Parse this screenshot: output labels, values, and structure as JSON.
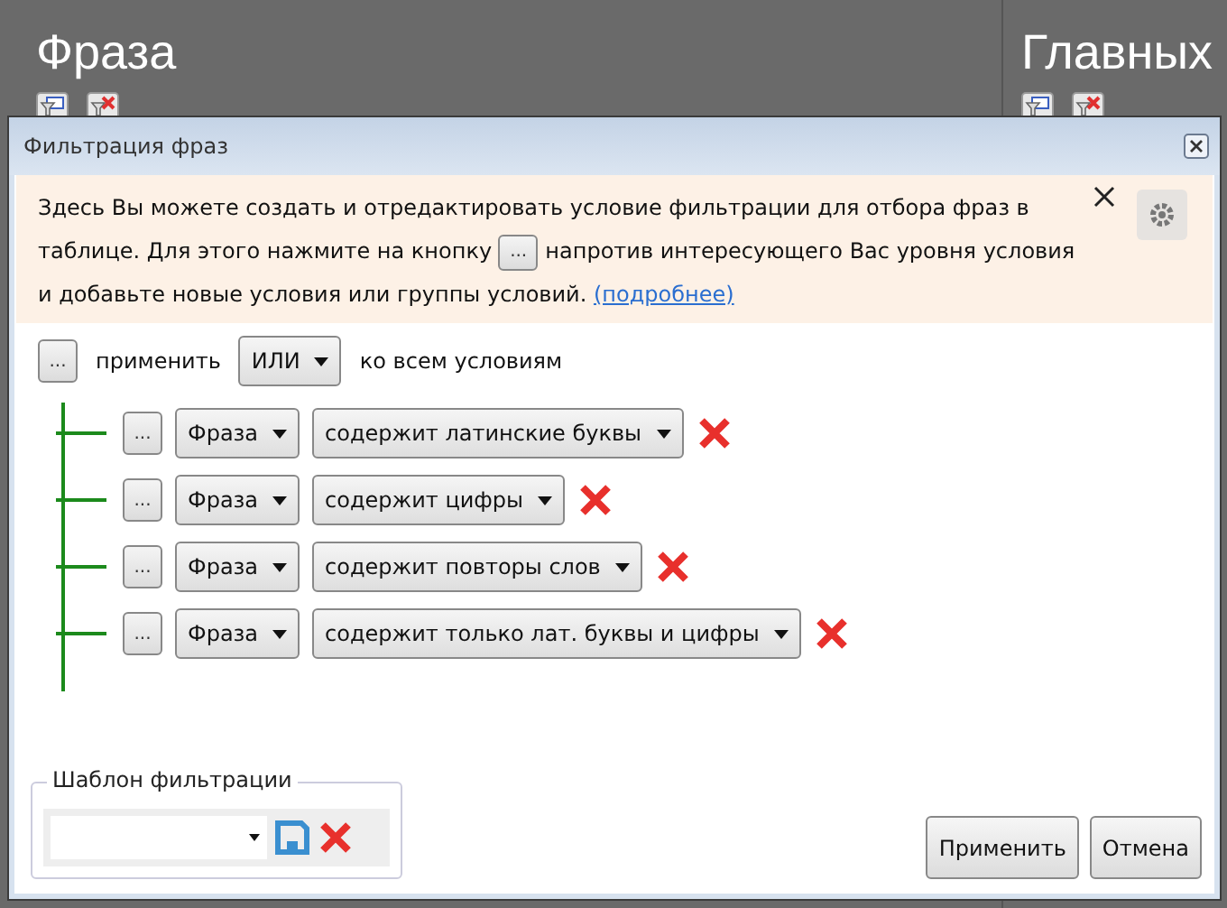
{
  "background": {
    "panels": [
      {
        "title": "Фраза"
      },
      {
        "title": "Главных"
      }
    ]
  },
  "dialog": {
    "title": "Фильтрация фраз",
    "info": {
      "text_before": "Здесь Вы можете создать и отредактировать условие фильтрации для отбора фраз в таблице. Для этого нажмите на кнопку",
      "button": "...",
      "text_after": "напротив интересующего Вас уровня условия и добавьте новые условия или группы условий.",
      "link": "(подробнее)"
    },
    "root": {
      "button": "...",
      "label_before": "применить",
      "operator": "ИЛИ",
      "label_after": "ко всем условиям"
    },
    "conditions": [
      {
        "button": "...",
        "field": "Фраза",
        "condition": "содержит латинские буквы"
      },
      {
        "button": "...",
        "field": "Фраза",
        "condition": "содержит цифры"
      },
      {
        "button": "...",
        "field": "Фраза",
        "condition": "содержит повторы слов"
      },
      {
        "button": "...",
        "field": "Фраза",
        "condition": "содержит только лат. буквы и цифры"
      }
    ],
    "template": {
      "legend": "Шаблон фильтрации"
    },
    "buttons": [
      "Применить",
      "Отмена"
    ]
  }
}
